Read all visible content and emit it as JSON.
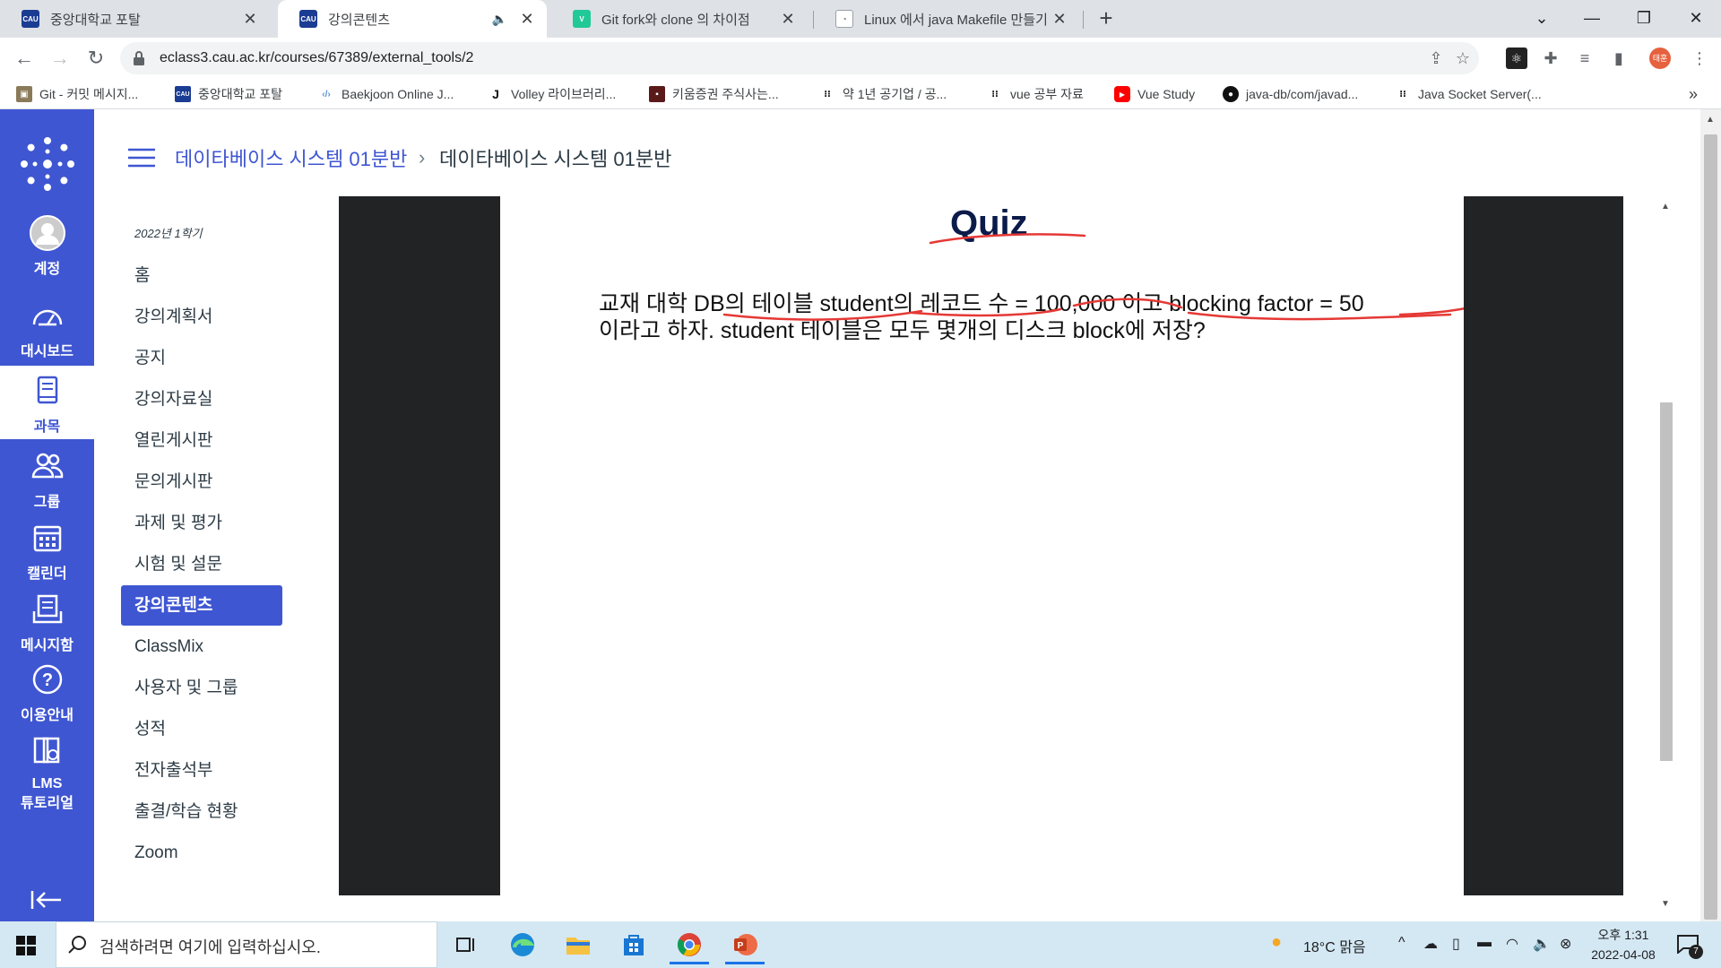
{
  "browser": {
    "tabs": [
      {
        "title": "중앙대학교 포탈",
        "favicon": "CAU"
      },
      {
        "title": "강의콘텐츠",
        "favicon": "CAU"
      },
      {
        "title": "Git fork와 clone 의 차이점",
        "favicon": "V"
      },
      {
        "title": "Linux 에서 java Makefile 만들기",
        "favicon": "fish"
      }
    ],
    "url": "eclass3.cau.ac.kr/courses/67389/external_tools/2",
    "profile_initials": "태훈",
    "bookmarks": [
      {
        "label": "Git - 커밋 메시지...",
        "icon": "git"
      },
      {
        "label": "중앙대학교 포탈",
        "icon": "CAU"
      },
      {
        "label": "Baekjoon Online J...",
        "icon": "code"
      },
      {
        "label": "Volley 라이브러리...",
        "icon": "J"
      },
      {
        "label": "키움증권 주식사는...",
        "icon": "kiwoom"
      },
      {
        "label": "약 1년 공기업 / 공...",
        "icon": "velog"
      },
      {
        "label": "vue 공부 자료",
        "icon": "velog"
      },
      {
        "label": "Vue Study",
        "icon": "youtube"
      },
      {
        "label": "java-db/com/javad...",
        "icon": "github"
      },
      {
        "label": "Java Socket Server(...",
        "icon": "velog"
      }
    ],
    "bookmarks_more": "»"
  },
  "global_nav": {
    "items": [
      {
        "label": "계정",
        "icon": "account-icon"
      },
      {
        "label": "대시보드",
        "icon": "dashboard-icon"
      },
      {
        "label": "과목",
        "icon": "courses-icon"
      },
      {
        "label": "그룹",
        "icon": "groups-icon"
      },
      {
        "label": "캘린더",
        "icon": "calendar-icon"
      },
      {
        "label": "메시지함",
        "icon": "inbox-icon"
      },
      {
        "label": "이용안내",
        "icon": "help-icon"
      },
      {
        "label_line1": "LMS",
        "label_line2": "튜토리얼",
        "icon": "tutorial-icon"
      }
    ]
  },
  "header": {
    "breadcrumb_link": "데이타베이스 시스템 01분반",
    "breadcrumb_sep": "›",
    "breadcrumb_current": "데이타베이스 시스템 01분반"
  },
  "course_nav": {
    "term": "2022년 1학기",
    "items": [
      "홈",
      "강의계획서",
      "공지",
      "강의자료실",
      "열린게시판",
      "문의게시판",
      "과제 및 평가",
      "시험 및 설문",
      "강의콘텐츠",
      "ClassMix",
      "사용자 및 그룹",
      "성적",
      "전자출석부",
      "출결/학습 현황",
      "Zoom"
    ],
    "active_index": 8
  },
  "slide": {
    "title": "Quiz",
    "line1": "교재 대학 DB의 테이블 student의 레코드 수 = 100,000 이고 blocking factor = 50",
    "line2": "이라고 하자. student 테이블은 모두 몇개의 디스크 block에 저장?",
    "ink_color": "#e53935"
  },
  "taskbar": {
    "search_placeholder": "검색하려면 여기에 입력하십시오.",
    "weather": "18°C  맑음",
    "time": "오후 1:31",
    "date": "2022-04-08",
    "notification_count": "7"
  },
  "colors": {
    "canvas_blue": "#3f56d2",
    "slide_sidebar": "#222325",
    "taskbar": "#d4e8f3"
  }
}
